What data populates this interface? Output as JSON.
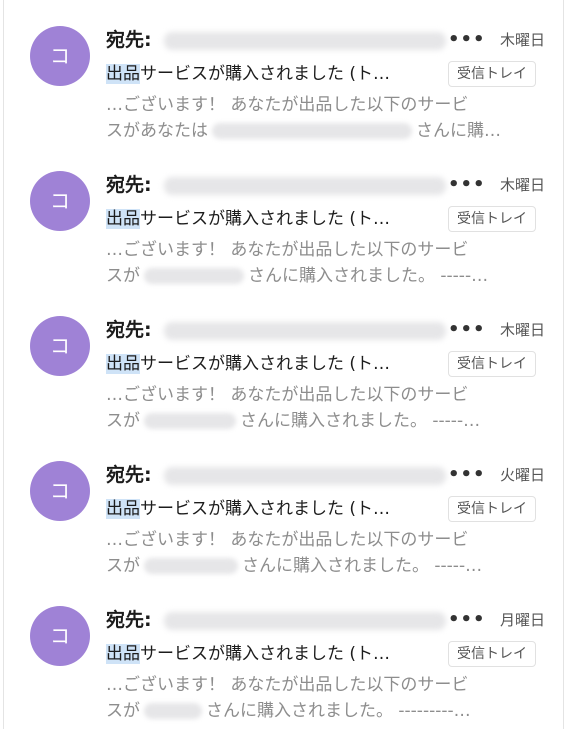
{
  "mails": [
    {
      "avatar_letter": "コ",
      "to_label": "宛先:",
      "more": "•••",
      "day": "木曜日",
      "subject_highlight": "出品",
      "subject_rest": "サービスが購入されました (ト…",
      "folder_tag": "受信トレイ",
      "snippet_line1": "…ございます！ あなたが出品した以下のサービ",
      "snippet_line2_pre": "スがあなたは",
      "snippet_line2_post": "さんに購…"
    },
    {
      "avatar_letter": "コ",
      "to_label": "宛先:",
      "more": "•••",
      "day": "木曜日",
      "subject_highlight": "出品",
      "subject_rest": "サービスが購入されました (ト…",
      "folder_tag": "受信トレイ",
      "snippet_line1": "…ございます！ あなたが出品した以下のサービ",
      "snippet_line2_pre": "スが",
      "snippet_line2_post": "さんに購入されました。 -----…"
    },
    {
      "avatar_letter": "コ",
      "to_label": "宛先:",
      "more": "•••",
      "day": "木曜日",
      "subject_highlight": "出品",
      "subject_rest": "サービスが購入されました (ト…",
      "folder_tag": "受信トレイ",
      "snippet_line1": "…ございます！ あなたが出品した以下のサービ",
      "snippet_line2_pre": "スが",
      "snippet_line2_post": "さんに購入されました。 -----…"
    },
    {
      "avatar_letter": "コ",
      "to_label": "宛先:",
      "more": "•••",
      "day": "火曜日",
      "subject_highlight": "出品",
      "subject_rest": "サービスが購入されました (ト…",
      "folder_tag": "受信トレイ",
      "snippet_line1": "…ございます！ あなたが出品した以下のサービ",
      "snippet_line2_pre": "スが",
      "snippet_line2_post": "さんに購入されました。 -----…"
    },
    {
      "avatar_letter": "コ",
      "to_label": "宛先:",
      "more": "•••",
      "day": "月曜日",
      "subject_highlight": "出品",
      "subject_rest": "サービスが購入されました (ト…",
      "folder_tag": "受信トレイ",
      "snippet_line1": "…ございます！ あなたが出品した以下のサービ",
      "snippet_line2_pre": "スが",
      "snippet_line2_post": "さんに購入されました。 ---------…"
    }
  ],
  "colors": {
    "avatar": "#9f82d6",
    "highlight": "#cfe3f7"
  }
}
